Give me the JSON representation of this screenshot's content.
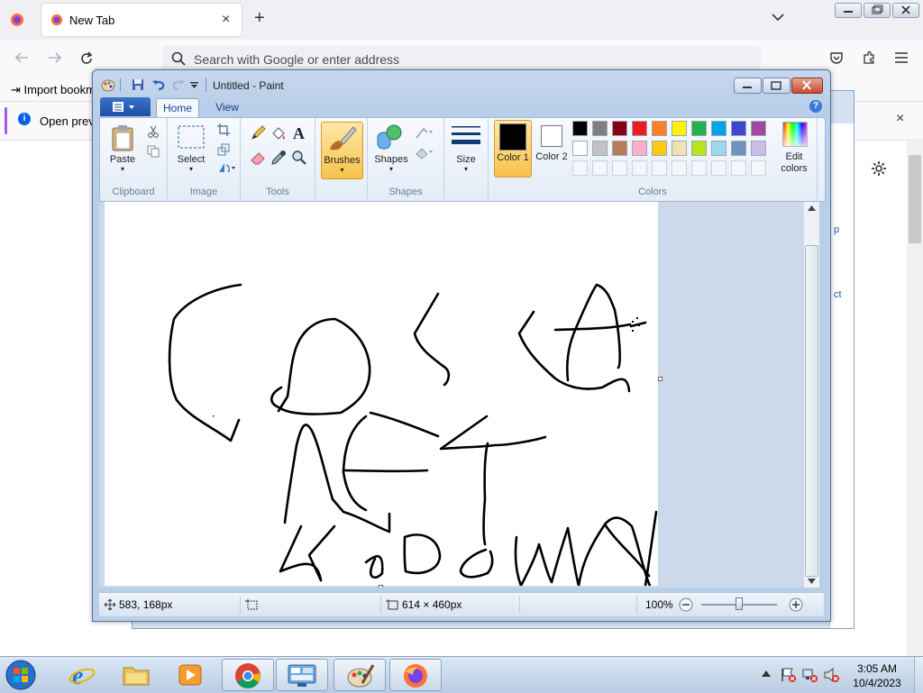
{
  "firefox": {
    "tab_title": "New Tab",
    "new_tab": "+",
    "url_placeholder": "Search with Google or enter address",
    "bookmark_item": "Import bookmarks...",
    "notice_text": "Open previous",
    "close_glyph": "×"
  },
  "background_dialog": {
    "side_texts": [
      "p",
      "ct"
    ]
  },
  "paint": {
    "title": "Untitled - Paint",
    "tabs": {
      "home": "Home",
      "view": "View"
    },
    "help": "?",
    "groups": {
      "clipboard": "Clipboard",
      "image": "Image",
      "tools": "Tools",
      "shapes": "Shapes",
      "colors": "Colors"
    },
    "buttons": {
      "paste": "Paste",
      "select": "Select",
      "brushes": "Brushes",
      "shapes": "Shapes",
      "size": "Size",
      "color1": "Color 1",
      "color2": "Color 2",
      "edit_colors": "Edit colors"
    },
    "palette_row1": [
      "#000000",
      "#7f7f7f",
      "#880015",
      "#ed1c24",
      "#ff7f27",
      "#fff200",
      "#22b14c",
      "#00a2e8",
      "#3f48cc",
      "#a349a4"
    ],
    "palette_row2": [
      "#ffffff",
      "#c3c3c3",
      "#b97a57",
      "#ffaec9",
      "#ffc90e",
      "#efe4b0",
      "#b5e61d",
      "#99d9ea",
      "#7092be",
      "#c8bfe7"
    ],
    "color1": "#000000",
    "color2": "#ffffff",
    "status": {
      "cursor": "583, 168px",
      "size": "614 × 460px",
      "zoom": "100%"
    }
  },
  "taskbar": {
    "time": "3:05 AM",
    "date": "10/4/2023",
    "apps": [
      "internet-explorer",
      "file-explorer",
      "media-player",
      "chrome",
      "control-panel",
      "paint",
      "firefox"
    ]
  }
}
